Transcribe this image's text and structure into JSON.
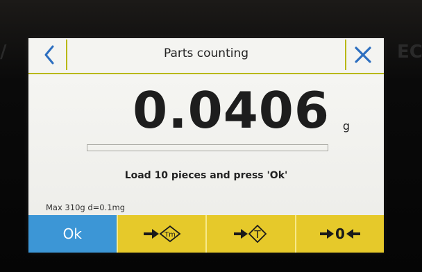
{
  "header": {
    "title": "Parts counting"
  },
  "display": {
    "weight": "0.0406",
    "unit": "g",
    "progress_fraction": 0.0
  },
  "instruction": "Load 10 pieces and press 'Ok'",
  "spec": "Max 310g   d=0.1mg",
  "toolbar": {
    "ok_label": "Ok",
    "tare_memory_label": "Tm",
    "tare_label": "T",
    "zero_label": "0"
  },
  "colors": {
    "accent_yellow": "#e6c92a",
    "ok_blue": "#3c96d6",
    "icon_blue": "#2d6fc0"
  },
  "icons": {
    "back": "chevron-left-icon",
    "close": "close-icon",
    "tare_memory": "arrow-tare-memory-icon",
    "tare": "arrow-tare-icon",
    "zero": "zero-arrows-icon"
  }
}
